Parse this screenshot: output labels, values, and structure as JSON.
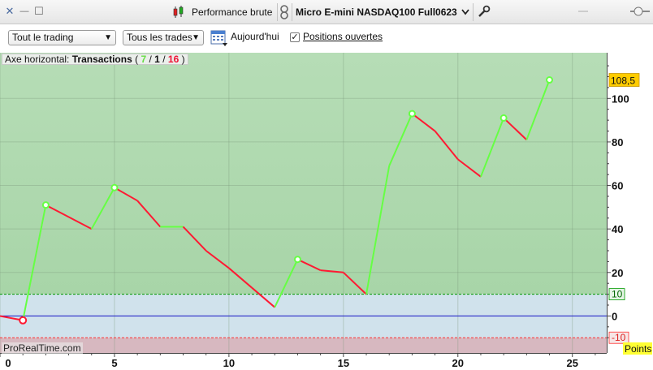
{
  "titlebar": {
    "close_glyph": "✕",
    "minimize_glyph": "—",
    "maximize_glyph": "☐",
    "report_name": "Performance brute",
    "instrument": "Micro E-mini NASDAQ100 Full0623",
    "icons": [
      "close-icon",
      "minimize-icon",
      "maximize-icon",
      "candlestick-icon",
      "link-icon",
      "chevron-down-icon",
      "wrench-icon",
      "slider-icon"
    ]
  },
  "toolbar": {
    "trading_select": "Tout le trading",
    "trades_select": "Tous les trades",
    "date_label": "Aujourd'hui",
    "open_positions_label": "Positions ouvertes",
    "open_positions_checked": true,
    "icons": [
      "calendar-icon"
    ]
  },
  "axis_title": {
    "prefix": "Axe horizontal:",
    "name": "Transactions",
    "open_paren": "(",
    "wins": "7",
    "sep1": "/",
    "neutral": "1",
    "sep2": "/",
    "losses": "16",
    "close_paren": ")"
  },
  "footer": {
    "logo": "ProRealTime.com",
    "units": "Points"
  },
  "colors": {
    "gain_zone": "#a8d5a8",
    "mid_zone": "#d0e2ec",
    "loss_zone": "#d7b8c0",
    "up_line": "#66ff44",
    "down_line": "#ff1a33",
    "zero_line": "#1a1acc",
    "last_value_bg": "#ffcc00",
    "units_bg": "#ffff33",
    "upper_threshold": "#009900",
    "lower_threshold": "#ff3333"
  },
  "chart_data": {
    "type": "line",
    "x_label": "Transactions",
    "y_label": "",
    "x": [
      0,
      1,
      2,
      4,
      5,
      6,
      7,
      8,
      9,
      10,
      11,
      12,
      13,
      14,
      15,
      16,
      17,
      18,
      19,
      20,
      21,
      22,
      23,
      24
    ],
    "y": [
      0,
      -2,
      51,
      40,
      59,
      53,
      41,
      41,
      30,
      22,
      13,
      4,
      26,
      21,
      20,
      10,
      69,
      93,
      85,
      72,
      64,
      91,
      81,
      108.5
    ],
    "xlim": [
      0,
      26.5
    ],
    "ylim": [
      -17,
      121
    ],
    "x_ticks": [
      0,
      5,
      10,
      15,
      20,
      25
    ],
    "y_ticks": [
      0,
      20,
      40,
      60,
      80,
      100
    ],
    "upper_threshold": 10,
    "lower_threshold": -10,
    "last_value": "108,5",
    "upper_threshold_label": "10",
    "lower_threshold_label": "-10",
    "zero_label": "0",
    "grid": true
  }
}
